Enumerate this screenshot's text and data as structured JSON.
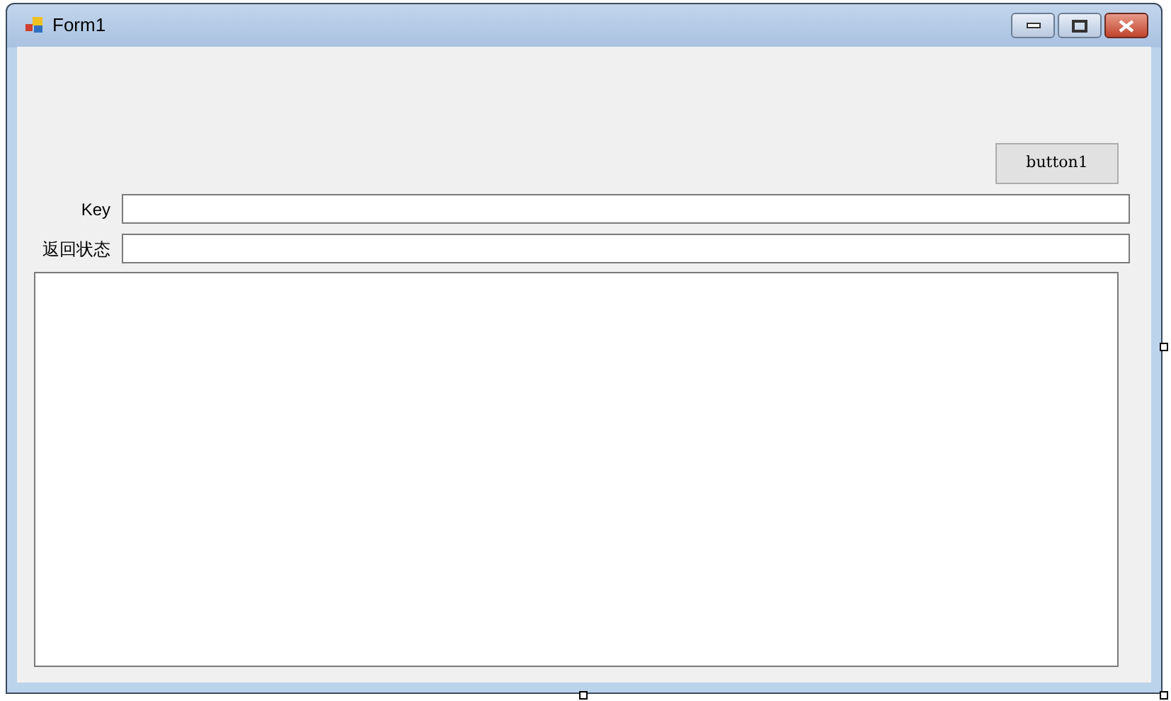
{
  "window": {
    "title": "Form1"
  },
  "button": {
    "label": "button1"
  },
  "fields": [
    {
      "label": "Key"
    },
    {
      "label": "返回状态"
    }
  ],
  "output_box": {
    "kind": "multiline"
  }
}
